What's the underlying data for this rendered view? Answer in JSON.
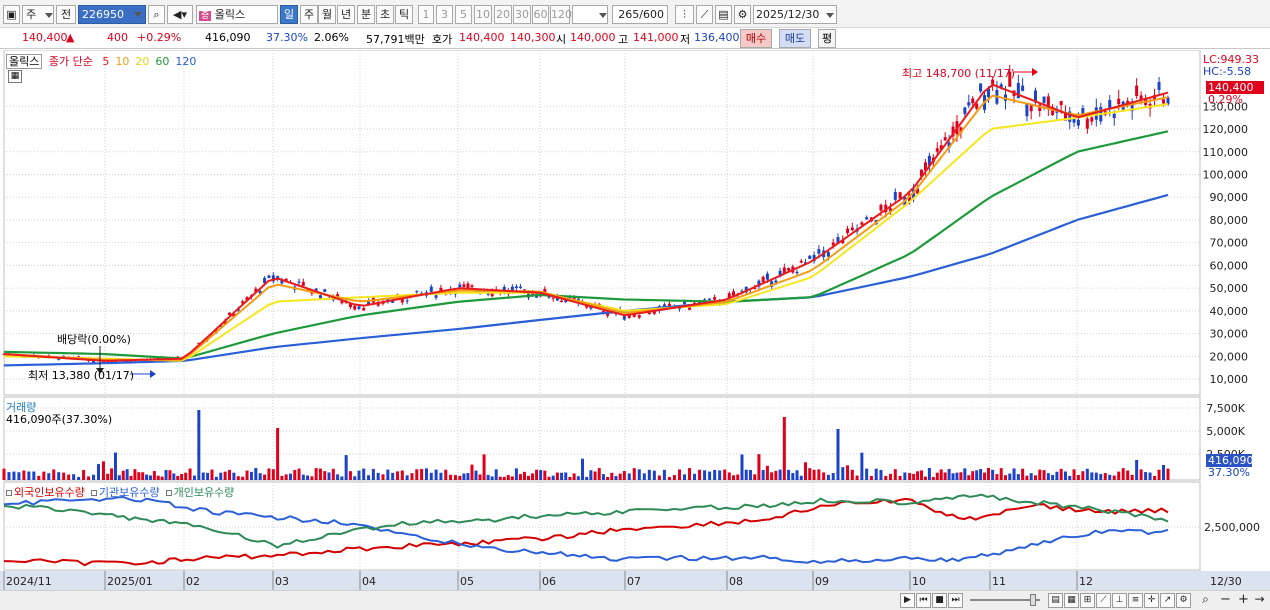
{
  "toolbar": {
    "market_btn": "주",
    "prev_btn": "전",
    "stock_code": "226950",
    "stock_name": "올릭스",
    "period_tabs": [
      "일",
      "주",
      "월",
      "년",
      "분",
      "초",
      "틱"
    ],
    "active_period": "일",
    "interval_btns": [
      "1",
      "3",
      "5",
      "10",
      "20",
      "30",
      "60",
      "120"
    ],
    "count_value": "265",
    "count_total": "/600",
    "date_value": "2025/12/30",
    "name_prefix_icon": "증"
  },
  "quote": {
    "price": "140,400",
    "change_arrow": "▲",
    "change": "400",
    "change_pct": "+0.29%",
    "volume": "416,090",
    "volume_ratio": "37.30%",
    "turnover_pct": "2.06%",
    "amount": "57,791백만",
    "hoga_label": "호가",
    "ask": "140,400",
    "bid": "140,300",
    "open_label": "시",
    "open": "140,000",
    "high_label": "고",
    "high": "141,000",
    "low_label": "저",
    "low": "136,400",
    "buy_btn": "매수",
    "sell_btn": "매도",
    "eval_btn": "평"
  },
  "price_panel": {
    "name_tag": "올릭스",
    "ma_label": "종가 단순",
    "ma_periods": [
      {
        "label": "5",
        "color": "#e81c1c"
      },
      {
        "label": "10",
        "color": "#f39c12"
      },
      {
        "label": "20",
        "color": "#e6d21a"
      },
      {
        "label": "60",
        "color": "#1e9a3c"
      },
      {
        "label": "120",
        "color": "#2a5fd8"
      }
    ],
    "lc_label": "LC:949.33",
    "hc_label": "HC:-5.58",
    "current_price_tag": "140,400",
    "current_pct_tag": "0.29%",
    "high_annotation": "최고 148,700 (11/17)",
    "low_annotation": "최저 13,380 (01/17)",
    "dividend_annotation": "배당락(0.00%)",
    "y_ticks": [
      "130,000",
      "120,000",
      "110,000",
      "100,000",
      "90,000",
      "80,000",
      "70,000",
      "60,000",
      "50,000",
      "40,000",
      "30,000",
      "20,000",
      "10,000"
    ]
  },
  "volume_panel": {
    "title": "거래량",
    "summary": "416,090주(37.30%)",
    "y_ticks": [
      "7,500K",
      "5,000K",
      "2,500K"
    ],
    "current_tag": "416,090",
    "current_pct": "37.30%"
  },
  "holding_panel": {
    "series": [
      {
        "label": "외국인보유수량",
        "color": "#d40000"
      },
      {
        "label": "기관보유수량",
        "color": "#2a5fd8"
      },
      {
        "label": "개인보유수량",
        "color": "#2e8b57"
      }
    ],
    "y_tick": "2,500,000"
  },
  "x_axis": {
    "labels": [
      "2024/11",
      "2025/01",
      "02",
      "03",
      "04",
      "05",
      "06",
      "07",
      "08",
      "09",
      "10",
      "11",
      "12"
    ],
    "end_label": "12/30"
  },
  "colors": {
    "up": "#e1001c",
    "down": "#1b43c9",
    "ma5": "#e81c1c",
    "ma10": "#f39c12",
    "ma20": "#f5e61e",
    "ma60": "#1e9a3c",
    "ma120": "#2a5fd8"
  },
  "chart_data": {
    "type": "line",
    "title": "",
    "ylabel": "",
    "ylim": [
      3000,
      153000
    ],
    "x": [
      "2024/11",
      "2025/01",
      "02",
      "03",
      "04",
      "05",
      "06",
      "07",
      "08",
      "09",
      "10",
      "11",
      "12",
      "12/30"
    ],
    "series": [
      {
        "name": "5",
        "values": [
          21000,
          18000,
          19000,
          55000,
          42000,
          50000,
          48000,
          38000,
          45000,
          62000,
          92000,
          140000,
          125000,
          136000
        ]
      },
      {
        "name": "10",
        "values": [
          21000,
          18500,
          18500,
          52000,
          44000,
          49000,
          48500,
          39000,
          44000,
          58000,
          90000,
          135000,
          126000,
          134000
        ]
      },
      {
        "name": "20",
        "values": [
          20000,
          19000,
          18000,
          44000,
          46000,
          48000,
          48000,
          40000,
          43000,
          55000,
          88000,
          120000,
          125000,
          131000
        ]
      },
      {
        "name": "60",
        "values": [
          22000,
          21000,
          19000,
          30000,
          38000,
          44000,
          47000,
          45000,
          44000,
          46000,
          65000,
          90000,
          110000,
          119000
        ]
      },
      {
        "name": "120",
        "values": [
          16000,
          17000,
          18000,
          24000,
          28000,
          32000,
          36000,
          40000,
          44000,
          46000,
          55000,
          65000,
          80000,
          91000
        ]
      }
    ],
    "annotations": [
      "최고 148,700 (11/17)",
      "최저 13,380 (01/17)"
    ]
  }
}
